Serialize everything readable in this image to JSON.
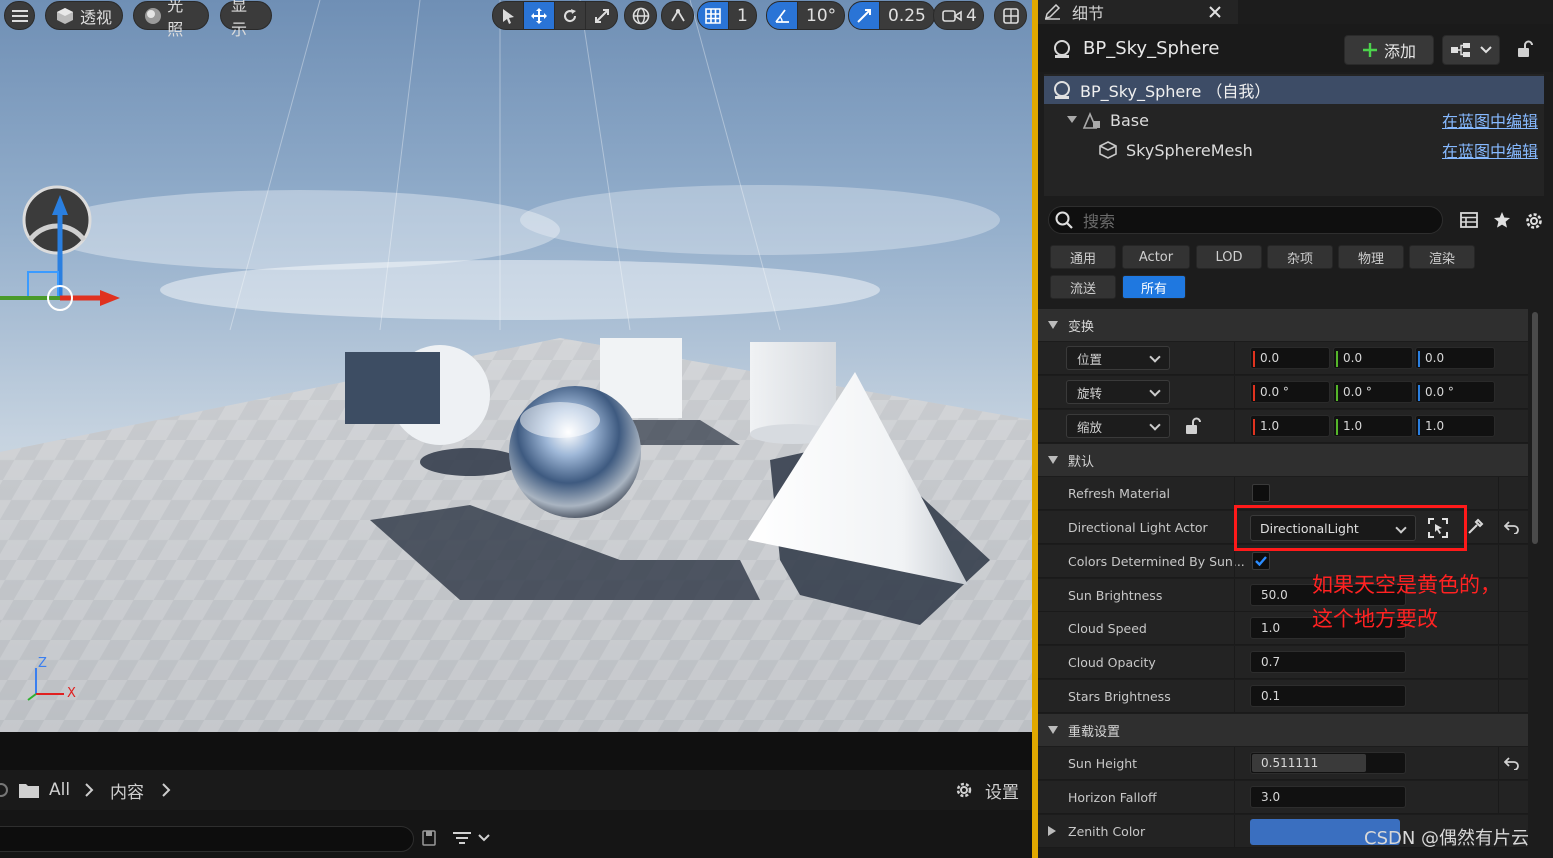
{
  "viewport": {
    "view_mode": "透视",
    "lit_mode": "光照",
    "show": "显示",
    "grid_snap": "1",
    "rot_snap": "10°",
    "scale_snap": "0.25",
    "camera_speed": "4",
    "axis_z": "Z",
    "axis_x": "X"
  },
  "content_browser": {
    "path_root": "All",
    "path_folder": "内容",
    "settings_label": "设置"
  },
  "details": {
    "tab_title": "细节",
    "actor_name": "BP_Sky_Sphere",
    "add_label": "添加",
    "tree": {
      "self": "BP_Sky_Sphere （自我）",
      "base": "Base",
      "mesh": "SkySphereMesh",
      "edit_link": "在蓝图中编辑"
    },
    "search_placeholder": "搜索",
    "filters": [
      "通用",
      "Actor",
      "LOD",
      "杂项",
      "物理",
      "渲染",
      "流送",
      "所有"
    ],
    "active_filter": "所有",
    "transform": {
      "title": "变换",
      "location_label": "位置",
      "rotation_label": "旋转",
      "scale_label": "缩放",
      "location": [
        "0.0",
        "0.0",
        "0.0"
      ],
      "rotation": [
        "0.0 °",
        "0.0 °",
        "0.0 °"
      ],
      "scale": [
        "1.0",
        "1.0",
        "1.0"
      ]
    },
    "default": {
      "title": "默认",
      "refresh_material": "Refresh Material",
      "directional_light_actor": "Directional Light Actor",
      "directional_light_value": "DirectionalLight",
      "colors_by_sun": "Colors Determined By Sun...",
      "sun_brightness": "Sun Brightness",
      "sun_brightness_val": "50.0",
      "cloud_speed": "Cloud Speed",
      "cloud_speed_val": "1.0",
      "cloud_opacity": "Cloud Opacity",
      "cloud_opacity_val": "0.7",
      "stars_brightness": "Stars Brightness",
      "stars_brightness_val": "0.1"
    },
    "override": {
      "title": "重载设置",
      "sun_height": "Sun Height",
      "sun_height_val": "0.511111",
      "sun_height_fill": 0.74,
      "horizon_falloff": "Horizon Falloff",
      "horizon_falloff_val": "3.0",
      "zenith_color": "Zenith Color",
      "zenith_color_hex": "#3a6fc0"
    }
  },
  "annotation": {
    "line1": "如果天空是黄色的，",
    "line2": "这个地方要改",
    "color": "#ff2222"
  },
  "watermark": "CSDN @偶然有片云",
  "colors": {
    "accent": "#1f78e0",
    "panel_border": "#e0a800",
    "link": "#86b9ff"
  }
}
